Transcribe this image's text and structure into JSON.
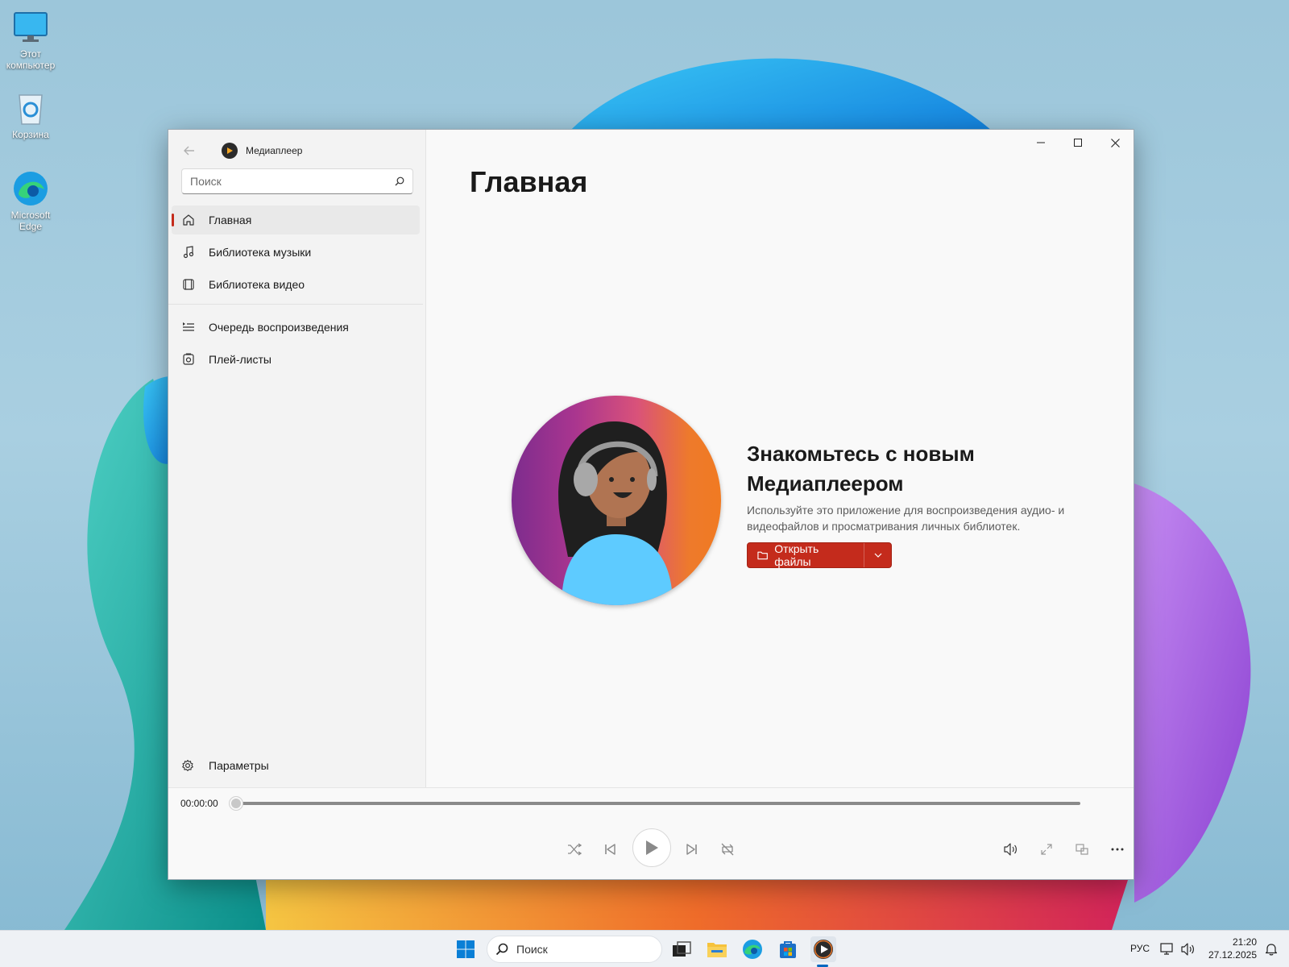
{
  "desktop": {
    "icons": [
      {
        "label": "Этот компьютер",
        "icon": "monitor-icon"
      },
      {
        "label": "Корзина",
        "icon": "recycle-bin-icon"
      },
      {
        "label": "Microsoft Edge",
        "icon": "edge-icon"
      }
    ]
  },
  "window": {
    "app_title": "Медиаплеер",
    "search_placeholder": "Поиск",
    "nav": [
      {
        "label": "Главная",
        "icon": "home-icon",
        "active": true
      },
      {
        "label": "Библиотека музыки",
        "icon": "music-note-icon"
      },
      {
        "label": "Библиотека видео",
        "icon": "film-icon"
      },
      {
        "label": "Очередь воспроизведения",
        "icon": "queue-icon"
      },
      {
        "label": "Плей-листы",
        "icon": "playlist-icon"
      }
    ],
    "settings_label": "Параметры",
    "page_title": "Главная",
    "hero": {
      "title": "Знакомьтесь с новым Медиаплеером",
      "description": "Используйте это приложение для воспроизведения аудио- и видеофайлов и просматривания личных библиотек.",
      "button_label": "Открыть файлы"
    },
    "player": {
      "time": "00:00:00",
      "progress": 0
    },
    "accent_color": "#c42b1c"
  },
  "taskbar": {
    "search_label": "Поиск",
    "language": "РУС",
    "time": "21:20",
    "date": "27.12.2025"
  }
}
